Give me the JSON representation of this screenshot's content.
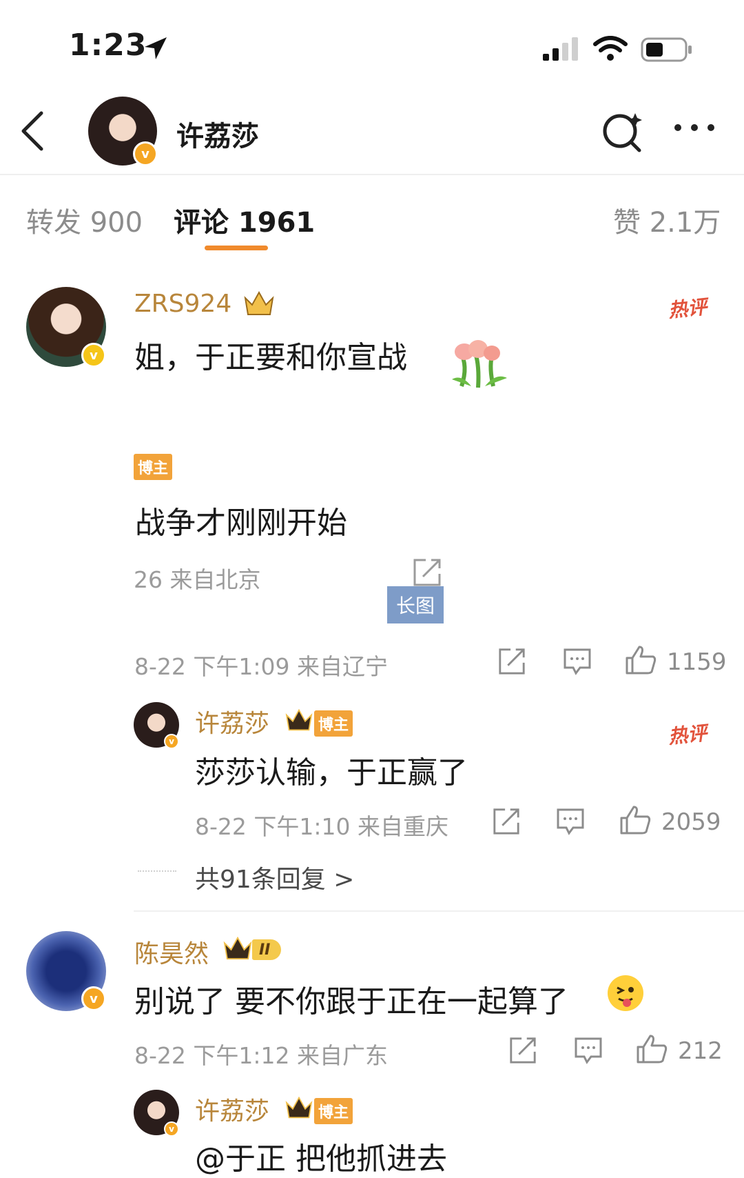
{
  "status_bar": {
    "time": "1:23"
  },
  "header": {
    "username": "许荔莎"
  },
  "tabs": [
    {
      "label": "转发 900"
    },
    {
      "label": "评论 1961"
    },
    {
      "label": "赞 2.1万"
    }
  ],
  "comments": [
    {
      "username": "ZRS924",
      "text": "姐，于正要和你宣战",
      "hot_label": "热评",
      "embedded": {
        "tag": "博主",
        "text": "战争才刚刚开始",
        "meta": "26 来自北京",
        "long_image_label": "长图"
      },
      "time": "8-22 下午1:09 来自辽宁",
      "likes": "1159",
      "reply": {
        "username": "许荔莎",
        "tag": "博主",
        "hot_label": "热评",
        "text": "莎莎认输，于正赢了",
        "time": "8-22 下午1:10 来自重庆",
        "likes": "2059"
      },
      "more_replies": "共91条回复 >"
    },
    {
      "username": "陈昊然",
      "level_badge": "II",
      "text": "别说了 要不你跟于正在一起算了",
      "time": "8-22 下午1:12 来自广东",
      "likes": "212",
      "reply": {
        "username": "许荔莎",
        "tag": "博主",
        "text": "@于正 把他抓进去"
      }
    }
  ],
  "colors": {
    "accent": "#f08a2c",
    "username": "#b8863b",
    "hot": "#e2533c",
    "verified": "#f5a623"
  }
}
